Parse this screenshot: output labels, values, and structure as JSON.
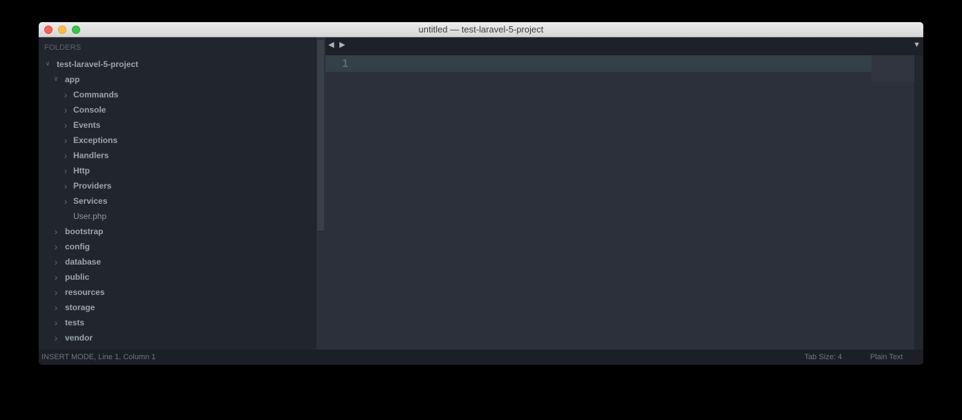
{
  "window": {
    "title": "untitled — test-laravel-5-project"
  },
  "sidebar": {
    "header": "FOLDERS",
    "tree": [
      {
        "label": "test-laravel-5-project",
        "expanded": true,
        "folder": true,
        "depth": 0
      },
      {
        "label": "app",
        "expanded": true,
        "folder": true,
        "depth": 1
      },
      {
        "label": "Commands",
        "expanded": false,
        "folder": true,
        "depth": 2
      },
      {
        "label": "Console",
        "expanded": false,
        "folder": true,
        "depth": 2
      },
      {
        "label": "Events",
        "expanded": false,
        "folder": true,
        "depth": 2
      },
      {
        "label": "Exceptions",
        "expanded": false,
        "folder": true,
        "depth": 2
      },
      {
        "label": "Handlers",
        "expanded": false,
        "folder": true,
        "depth": 2
      },
      {
        "label": "Http",
        "expanded": false,
        "folder": true,
        "depth": 2
      },
      {
        "label": "Providers",
        "expanded": false,
        "folder": true,
        "depth": 2
      },
      {
        "label": "Services",
        "expanded": false,
        "folder": true,
        "depth": 2
      },
      {
        "label": "User.php",
        "expanded": false,
        "folder": false,
        "depth": 2
      },
      {
        "label": "bootstrap",
        "expanded": false,
        "folder": true,
        "depth": 1
      },
      {
        "label": "config",
        "expanded": false,
        "folder": true,
        "depth": 1
      },
      {
        "label": "database",
        "expanded": false,
        "folder": true,
        "depth": 1
      },
      {
        "label": "public",
        "expanded": false,
        "folder": true,
        "depth": 1
      },
      {
        "label": "resources",
        "expanded": false,
        "folder": true,
        "depth": 1
      },
      {
        "label": "storage",
        "expanded": false,
        "folder": true,
        "depth": 1
      },
      {
        "label": "tests",
        "expanded": false,
        "folder": true,
        "depth": 1
      },
      {
        "label": "vendor",
        "expanded": false,
        "folder": true,
        "depth": 1
      }
    ]
  },
  "tabbar": {
    "nav_left": "◀",
    "nav_right": "▶",
    "dropdown": "▼"
  },
  "editor": {
    "line_number": "1"
  },
  "statusbar": {
    "mode": "INSERT MODE, Line 1, Column 1",
    "tab_size": "Tab Size: 4",
    "syntax": "Plain Text"
  },
  "colors": {
    "sidebar_bg": "#21262e",
    "editor_bg": "#2b303b",
    "current_line": "#344048"
  }
}
